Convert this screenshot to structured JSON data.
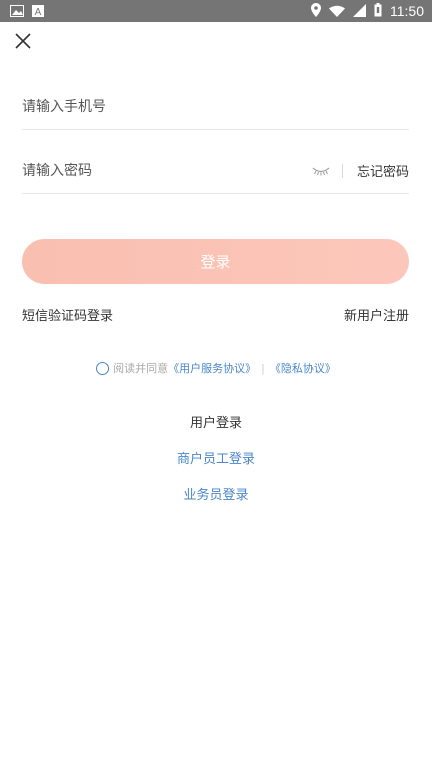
{
  "status_bar": {
    "time": "11:50",
    "icons": [
      "image-icon",
      "text-a-icon",
      "location-icon",
      "wifi-icon",
      "signal-icon",
      "battery-icon"
    ]
  },
  "form": {
    "phone_placeholder": "请输入手机号",
    "password_placeholder": "请输入密码",
    "forgot_label": "忘记密码",
    "login_label": "登录"
  },
  "links": {
    "sms_login": "短信验证码登录",
    "register": "新用户注册"
  },
  "agreement": {
    "prefix": "阅读并同意",
    "user_agreement": "《用户服务协议》",
    "separator": "|",
    "privacy": "《隐私协议》"
  },
  "roles": {
    "user": "用户登录",
    "merchant_staff": "商户员工登录",
    "salesperson": "业务员登录"
  },
  "colors": {
    "accent_blue": "#4a86c8",
    "button_pink": "#f9bfb0",
    "status_bar": "#757575"
  }
}
